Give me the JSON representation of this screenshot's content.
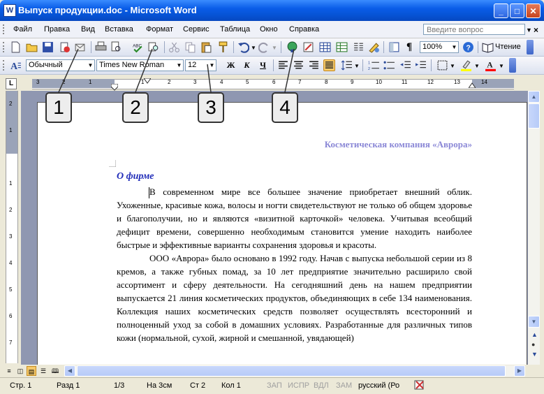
{
  "window": {
    "title": "Выпуск продукции.doc - Microsoft Word",
    "app_icon": "W",
    "minimize": "_",
    "maximize": "□",
    "close": "✕"
  },
  "menu": {
    "items": [
      "Файл",
      "Правка",
      "Вид",
      "Вставка",
      "Формат",
      "Сервис",
      "Таблица",
      "Окно",
      "Справка"
    ],
    "help_placeholder": "Введите вопрос",
    "doc_close": "×"
  },
  "standard_toolbar": {
    "zoom": "100%",
    "reading_label": "Чтение"
  },
  "formatting_toolbar": {
    "style": "Обычный",
    "font": "Times New Roman",
    "size": "12",
    "bold": "Ж",
    "italic": "К",
    "underline": "Ч",
    "highlight_color": "#FFFF00",
    "font_color": "#FF0000"
  },
  "ruler": {
    "corner": "L",
    "ticks": [
      "3",
      "2",
      "1",
      "1",
      "2",
      "3",
      "4",
      "5",
      "6",
      "7",
      "8",
      "9",
      "10",
      "11",
      "12",
      "13",
      "14"
    ]
  },
  "vruler": {
    "ticks": [
      "2",
      "1",
      "1",
      "2",
      "3",
      "4",
      "5",
      "6",
      "7"
    ]
  },
  "callouts": [
    "1",
    "2",
    "3",
    "4"
  ],
  "document": {
    "header": "Косметическая компания «Аврора»",
    "heading": "О фирме",
    "paragraphs": [
      "В современном мире все большее значение приобретает внешний облик. Ухоженные, красивые кожа, волосы и ногти свидетельствуют не только об общем здоровье и благополучии, но и являются «визитной карточкой» человека. Учитывая всеобщий дефицит времени, совершенно необходимым становится умение находить наиболее быстрые и эффективные варианты сохранения здоровья и красоты.",
      "ООО «Аврора» было основано в 1992 году. Начав с выпуска небольшой серии из 8 кремов, а также губных помад, за 10 лет предприятие значительно расширило свой ассортимент и сферу деятельности. На сегодняшний день на нашем предприятии выпускается 21 линия косметических продуктов, объединяющих в себе 134 наименования. Коллекция наших косметических средств позволяет осуществлять всесторонний и полноценный уход за собой в домашних условиях. Разработанные для различных типов кожи (нормальной, сухой, жирной и смешанной, увядающей)"
    ],
    "heading_color": "#1F2BB8",
    "header_color": "#8A87D6"
  },
  "status": {
    "page": "Стр. 1",
    "section": "Разд 1",
    "pages": "1/3",
    "at": "На 3см",
    "line": "Ст 2",
    "col": "Кол 1",
    "rec": "ЗАП",
    "trk": "ИСПР",
    "ext": "ВДЛ",
    "ovr": "ЗАМ",
    "language": "русский (Ро"
  }
}
